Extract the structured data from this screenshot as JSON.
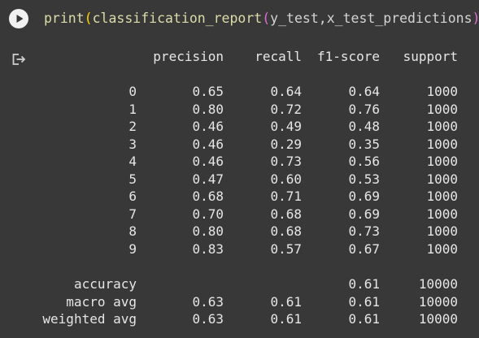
{
  "cell": {
    "code": {
      "fn": "print",
      "open1": "(",
      "fn2": "classification_report",
      "open2": "(",
      "args": "y_test,x_test_predictions",
      "close2": ")",
      "close1": ")"
    },
    "run_icon": "play-icon",
    "output_icon": "output-redirect-icon"
  },
  "report": {
    "headers": [
      "precision",
      "recall",
      "f1-score",
      "support"
    ],
    "classes": [
      {
        "label": "0",
        "precision": "0.65",
        "recall": "0.64",
        "f1": "0.64",
        "support": "1000"
      },
      {
        "label": "1",
        "precision": "0.80",
        "recall": "0.72",
        "f1": "0.76",
        "support": "1000"
      },
      {
        "label": "2",
        "precision": "0.46",
        "recall": "0.49",
        "f1": "0.48",
        "support": "1000"
      },
      {
        "label": "3",
        "precision": "0.46",
        "recall": "0.29",
        "f1": "0.35",
        "support": "1000"
      },
      {
        "label": "4",
        "precision": "0.46",
        "recall": "0.73",
        "f1": "0.56",
        "support": "1000"
      },
      {
        "label": "5",
        "precision": "0.47",
        "recall": "0.60",
        "f1": "0.53",
        "support": "1000"
      },
      {
        "label": "6",
        "precision": "0.68",
        "recall": "0.71",
        "f1": "0.69",
        "support": "1000"
      },
      {
        "label": "7",
        "precision": "0.70",
        "recall": "0.68",
        "f1": "0.69",
        "support": "1000"
      },
      {
        "label": "8",
        "precision": "0.80",
        "recall": "0.68",
        "f1": "0.73",
        "support": "1000"
      },
      {
        "label": "9",
        "precision": "0.83",
        "recall": "0.57",
        "f1": "0.67",
        "support": "1000"
      }
    ],
    "accuracy": {
      "label": "accuracy",
      "f1": "0.61",
      "support": "10000"
    },
    "macro_avg": {
      "label": "macro avg",
      "precision": "0.63",
      "recall": "0.61",
      "f1": "0.61",
      "support": "10000"
    },
    "weighted_avg": {
      "label": "weighted avg",
      "precision": "0.63",
      "recall": "0.61",
      "f1": "0.61",
      "support": "10000"
    }
  }
}
